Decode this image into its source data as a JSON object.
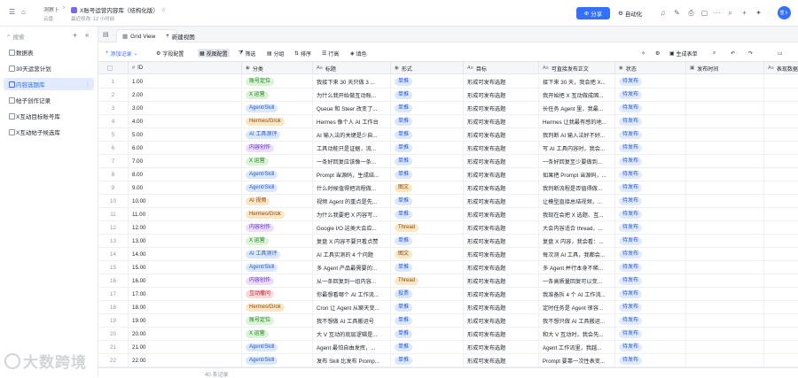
{
  "header": {
    "breadcrumb": "洞察卜",
    "doc_title": "X账号运营内容库（结构化版）",
    "location": "云盘",
    "last_modified": "最近修改: 12 小时前",
    "share_label": "分享",
    "auto_label": "自动化",
    "avatar_text": "雪卜"
  },
  "sidebar": {
    "search_placeholder": "搜索",
    "items": [
      "数据表",
      "30天运营计划",
      "内容选题库",
      "帖子创作记录",
      "X互动目标账号库",
      "X互动帖子候选库"
    ],
    "active_index": 2
  },
  "tabs": [
    {
      "label": "Grid View",
      "active": true
    },
    {
      "label": "新建视图",
      "active": false
    }
  ],
  "toolbar": {
    "add_record": "添加记录",
    "field_config": "字段配置",
    "view_config": "视图配置",
    "filter": "筛选",
    "group": "分组",
    "sort": "排序",
    "row_height": "行高",
    "fill_color": "填色",
    "generate_form": "生成表单"
  },
  "columns": [
    {
      "label": "ID",
      "icon": "#"
    },
    {
      "label": "分类",
      "icon": "◉"
    },
    {
      "label": "标题",
      "icon": "A≡"
    },
    {
      "label": "形式",
      "icon": "◉"
    },
    {
      "label": "目标",
      "icon": "A≡"
    },
    {
      "label": "可直接发布正文",
      "icon": "A≡"
    },
    {
      "label": "状态",
      "icon": "◉"
    },
    {
      "label": "发布时间",
      "icon": "▣"
    },
    {
      "label": "表现数据",
      "icon": "A≡"
    }
  ],
  "colors": {
    "账号定位": {
      "bg": "#d9f5d6",
      "fg": "#1f7a1f"
    },
    "X 运营": {
      "bg": "#d9f5d6",
      "fg": "#1f7a1f"
    },
    "Agent/Skill": {
      "bg": "#dbe8fb",
      "fg": "#245bdb"
    },
    "Hermes/Grok": {
      "bg": "#fbe6c6",
      "fg": "#8f4b00"
    },
    "AI 工具测评": {
      "bg": "#dbe8fb",
      "fg": "#245bdb"
    },
    "内容创作": {
      "bg": "#ecdffc",
      "fg": "#6425d0"
    },
    "AI 视频": {
      "bg": "#fbe6c6",
      "fg": "#8f4b00"
    },
    "互动撒问": {
      "bg": "#fadadb",
      "fg": "#b8262b"
    },
    "单推": {
      "bg": "#dbe8fb",
      "fg": "#245bdb"
    },
    "图文": {
      "bg": "#fbe6c6",
      "fg": "#8f4b00"
    },
    "Thread": {
      "bg": "#fbe6c6",
      "fg": "#8f4b00"
    },
    "投票": {
      "bg": "#dbe8fb",
      "fg": "#245bdb"
    },
    "待发布": {
      "bg": "#e1eaff",
      "fg": "#245bdb"
    }
  },
  "rows": [
    {
      "n": "1",
      "id": "1.00",
      "cat": "账号定位",
      "title": "我接下来 30 天只做 3 ...",
      "form": "单推",
      "goal": "形成可发布选题",
      "body": "接下来 30 天，我会把 X...",
      "status": "待发布"
    },
    {
      "n": "2",
      "id": "2.00",
      "cat": "X 运营",
      "title": "为什么我开始做互动账...",
      "form": "单推",
      "goal": "形成可发布选题",
      "body": "我开始把 X 互动做成固...",
      "status": "待发布"
    },
    {
      "n": "3",
      "id": "3.00",
      "cat": "Agent/Skill",
      "title": "Queue 和 Steer 改变了...",
      "form": "单推",
      "goal": "形成可发布选题",
      "body": "长任务 Agent 里，我最...",
      "status": "待发布"
    },
    {
      "n": "4",
      "id": "4.00",
      "cat": "Hermes/Grok",
      "title": "Hermes 像个人 AI 工作台",
      "form": "单推",
      "goal": "形成可发布选题",
      "body": "Hermes 让我最有感的地...",
      "status": "待发布"
    },
    {
      "n": "5",
      "id": "5.00",
      "cat": "AI 工具测评",
      "title": "AI 输入法的关键是少自...",
      "form": "单推",
      "goal": "形成可发布选题",
      "body": "我判断 AI 输入法好不好...",
      "status": "待发布"
    },
    {
      "n": "6",
      "id": "6.00",
      "cat": "内容创作",
      "title": "工具动能只是证据，流...",
      "form": "单推",
      "goal": "形成可发布选题",
      "body": "写 AI 工具内容时，我会...",
      "status": "待发布"
    },
    {
      "n": "7",
      "id": "7.00",
      "cat": "X 运营",
      "title": "一条好回复应该像一条...",
      "form": "单推",
      "goal": "形成可发布选题",
      "body": "一条好回复至少要做到...",
      "status": "待发布"
    },
    {
      "n": "8",
      "id": "8.00",
      "cat": "Agent/Skill",
      "title": "Prompt 当源码，生成结...",
      "form": "单推",
      "goal": "形成可发布选题",
      "body": "如果把 Prompt 当源码，...",
      "status": "待发布"
    },
    {
      "n": "9",
      "id": "9.00",
      "cat": "Agent/Skill",
      "title": "什么时候值得把流程做...",
      "form": "图文",
      "goal": "形成可发布选题",
      "body": "我判断流程是否值得做...",
      "status": "待发布"
    },
    {
      "n": "10",
      "id": "10.00",
      "cat": "AI 视频",
      "title": "视频 Agent 的重点是先...",
      "form": "单推",
      "goal": "形成可发布选题",
      "body": "让模型直接总结视频，...",
      "status": "待发布"
    },
    {
      "n": "11",
      "id": "11.00",
      "cat": "Hermes/Grok",
      "title": "为什么我要把 X 内容写...",
      "form": "单推",
      "goal": "形成可发布选题",
      "body": "我现在会把 X 选题、互...",
      "status": "待发布"
    },
    {
      "n": "12",
      "id": "12.00",
      "cat": "内容创作",
      "title": "Google I/O 这类大会应...",
      "form": "Thread",
      "goal": "形成可发布选题",
      "body": "大会内容适合 thread，...",
      "status": "待发布"
    },
    {
      "n": "13",
      "id": "13.00",
      "cat": "X 运营",
      "title": "复盘 X 内容不要只看点赞",
      "form": "单推",
      "goal": "形成可发布选题",
      "body": "复盘 X 内容，我会看：...",
      "status": "待发布"
    },
    {
      "n": "14",
      "id": "14.00",
      "cat": "AI 工具测评",
      "title": "AI 工具实测的 4 个问题",
      "form": "图文",
      "goal": "形成可发布选题",
      "body": "每次测 AI 工具，我都会...",
      "status": "待发布"
    },
    {
      "n": "15",
      "id": "15.00",
      "cat": "Agent/Skill",
      "title": "多 Agent 产品最需要的...",
      "form": "单推",
      "goal": "形成可发布选题",
      "body": "多 Agent 并行本身不稀...",
      "status": "待发布"
    },
    {
      "n": "16",
      "id": "16.00",
      "cat": "内容创作",
      "title": "从一条回复到一组内容...",
      "form": "Thread",
      "goal": "形成可发布选题",
      "body": "一条高质量回复可以变...",
      "status": "待发布"
    },
    {
      "n": "17",
      "id": "17.00",
      "cat": "互动撒问",
      "title": "你最想看哪个 AI 工作流...",
      "form": "投票",
      "goal": "形成可发布选题",
      "body": "我准备拆 4 个 AI 工作流...",
      "status": "待发布"
    },
    {
      "n": "18",
      "id": "18.00",
      "cat": "Hermes/Grok",
      "title": "Cron 让 Agent 从聊天变...",
      "form": "单推",
      "goal": "形成可发布选题",
      "body": "定时任务是 Agent 很容...",
      "status": "待发布"
    },
    {
      "n": "19",
      "id": "19.00",
      "cat": "账号定位",
      "title": "我不想做 AI 工具搬运号",
      "form": "单推",
      "goal": "形成可发布选题",
      "body": "我不想只做 AI 工具搬运...",
      "status": "待发布"
    },
    {
      "n": "20",
      "id": "20.00",
      "cat": "X 运营",
      "title": "大 V 互动的底层逻辑是...",
      "form": "单推",
      "goal": "形成可发布选题",
      "body": "和大 V 互动时，我会先...",
      "status": "待发布"
    },
    {
      "n": "21",
      "id": "21.00",
      "cat": "Agent/Skill",
      "title": "Agent 最怕自由发挥，...",
      "form": "单推",
      "goal": "形成可发布选题",
      "body": "Agent 工作流里，我越...",
      "status": "待发布"
    },
    {
      "n": "22",
      "id": "22.00",
      "cat": "Agent/Skill",
      "title": "发布 Skill 比发布 Promp...",
      "form": "单推",
      "goal": "形成可发布选题",
      "body": "Prompt 要靠一次性表变...",
      "status": "待发布"
    }
  ],
  "footer": {
    "count": "40 条记录"
  },
  "watermark": "大数跨境"
}
